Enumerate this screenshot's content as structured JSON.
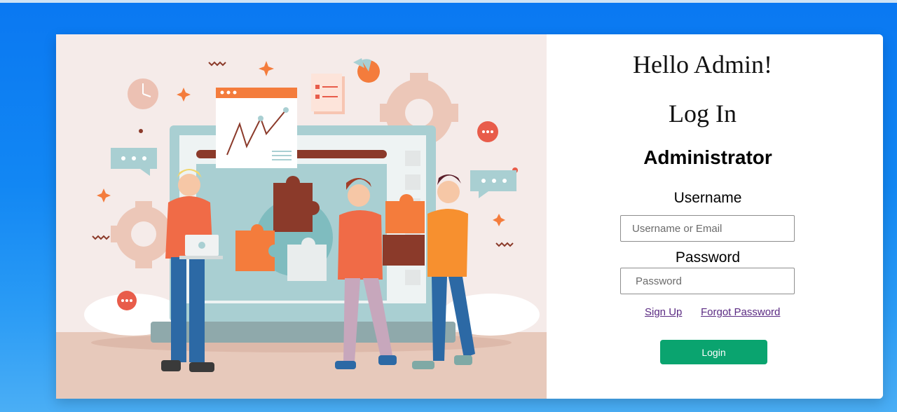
{
  "colors": {
    "page_bg": "#0a78f2",
    "card_bg": "#ffffff",
    "illustration_bg": "#f5ebe9",
    "login_button": "#0aa46f",
    "link": "#5a2a82",
    "accent_orange": "#f47c3c"
  },
  "login": {
    "greeting": "Hello Admin!",
    "title": "Log In",
    "role": "Administrator",
    "username_label": "Username",
    "username_placeholder": "Username or Email",
    "password_label": "Password",
    "password_placeholder": "Password",
    "signup_link": "Sign Up",
    "forgot_link": "Forgot Password",
    "submit_label": "Login"
  },
  "illustration": {
    "subject": "team-collaboration-puzzle",
    "icons": [
      "gear-icon",
      "chat-bubble-icon",
      "clock-icon",
      "pie-chart-icon",
      "checklist-icon",
      "line-chart-icon",
      "puzzle-icon",
      "laptop-icon"
    ]
  }
}
